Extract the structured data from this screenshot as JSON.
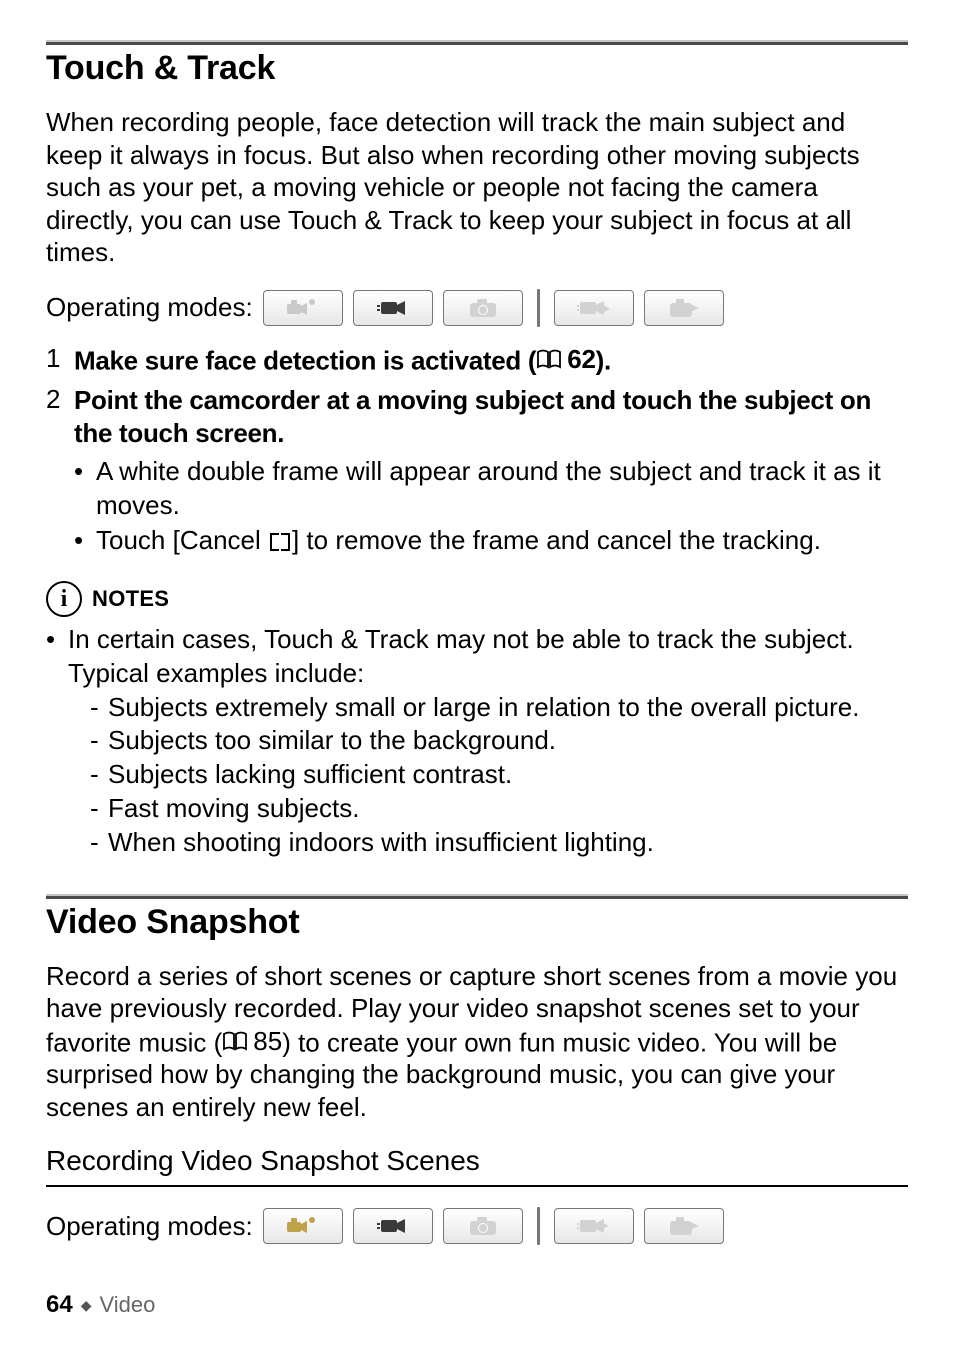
{
  "section1": {
    "title": "Touch & Track",
    "intro": "When recording people, face detection will track the main subject and keep it always in focus. But also when recording other moving subjects such as your pet, a moving vehicle or people not facing the camera directly, you can use Touch & Track to keep your subject in focus at all times.",
    "op_label": "Operating modes:",
    "step1_num": "1",
    "step1_pre": "Make sure face detection is activated (",
    "step1_ref": "62",
    "step1_post": ").",
    "step2_num": "2",
    "step2_text": "Point the camcorder at a moving subject and touch the subject on the touch screen.",
    "step2_bullet1": "A white double frame will appear around the subject and track it as it moves.",
    "step2_bullet2_pre": "Touch [Cancel ",
    "step2_bullet2_post": "] to remove the frame and cancel the tracking."
  },
  "notes": {
    "label": "NOTES",
    "lead": "In certain cases, Touch & Track may not be able to track the subject. Typical examples include:",
    "items": [
      "Subjects extremely small or large in relation to the overall picture.",
      "Subjects too similar to the background.",
      "Subjects lacking sufficient contrast.",
      "Fast moving subjects.",
      "When shooting indoors with insufficient lighting."
    ]
  },
  "section2": {
    "title": "Video Snapshot",
    "intro_pre": "Record a series of short scenes or capture short scenes from a movie you have previously recorded. Play your video snapshot scenes set to your favorite music (",
    "intro_ref": "85",
    "intro_post": ") to create your own fun music video. You will be surprised how by changing the background music, you can give your scenes an entirely new feel.",
    "subsection": "Recording Video Snapshot Scenes",
    "op_label": "Operating modes:"
  },
  "footer": {
    "page": "64",
    "category": "Video"
  },
  "mode_icons": {
    "row1": [
      {
        "name": "dual-mode-icon",
        "color": "#c9c9c9"
      },
      {
        "name": "movie-record-icon",
        "color": "#3a3a3a"
      },
      {
        "name": "photo-record-icon",
        "color": "#d2d2d2"
      },
      {
        "name": "movie-play-icon",
        "color": "#d2d2d2"
      },
      {
        "name": "photo-play-icon",
        "color": "#d2d2d2"
      }
    ],
    "row2": [
      {
        "name": "dual-mode-icon",
        "color": "#bfa24a"
      },
      {
        "name": "movie-record-icon",
        "color": "#3a3a3a"
      },
      {
        "name": "photo-record-icon",
        "color": "#d2d2d2"
      },
      {
        "name": "movie-play-icon",
        "color": "#d2d2d2"
      },
      {
        "name": "photo-play-icon",
        "color": "#d2d2d2"
      }
    ]
  }
}
